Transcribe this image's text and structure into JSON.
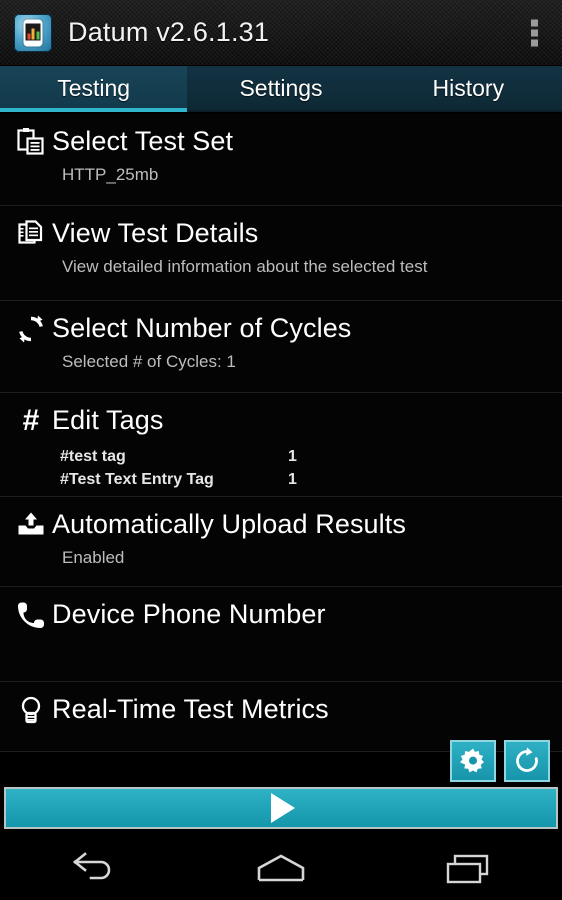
{
  "app": {
    "title": "Datum v2.6.1.31",
    "icon_name": "app-icon-phone-chart",
    "overflow_menu_label": "More options"
  },
  "theme": {
    "accent": "#1aa3b5",
    "accent_light": "#2fb6cc",
    "tabbar_bg": "#123243",
    "list_bg": "#040404",
    "title_text": "#ffffff",
    "subtitle_text": "#bdbdbd"
  },
  "tabs": [
    {
      "label": "Testing",
      "active": true
    },
    {
      "label": "Settings",
      "active": false
    },
    {
      "label": "History",
      "active": false
    }
  ],
  "list": [
    {
      "icon": "clipboard-document-icon",
      "title": "Select Test Set",
      "subtitle": "HTTP_25mb"
    },
    {
      "icon": "documents-copy-icon",
      "title": "View Test Details",
      "subtitle": "View detailed information about the selected test"
    },
    {
      "icon": "sync-cycles-icon",
      "title": "Select Number of Cycles",
      "subtitle": "Selected # of Cycles: 1"
    },
    {
      "icon": "hash-tag-icon",
      "title": "Edit Tags",
      "tags": [
        {
          "name": "#test tag",
          "value": "1"
        },
        {
          "name": "#Test Text Entry Tag",
          "value": "1"
        }
      ]
    },
    {
      "icon": "upload-tray-icon",
      "title": "Automatically Upload Results",
      "subtitle": "Enabled"
    },
    {
      "icon": "phone-handset-icon",
      "title": "Device Phone Number",
      "subtitle": ""
    },
    {
      "icon": "lightbulb-icon",
      "title": "Real-Time Test Metrics",
      "subtitle": ""
    }
  ],
  "fabs": [
    {
      "icon": "gear-icon",
      "label": "Settings"
    },
    {
      "icon": "refresh-icon",
      "label": "Refresh"
    }
  ],
  "play_button": {
    "icon": "play-icon",
    "label": "Start Test"
  },
  "navbar": [
    {
      "icon": "back-icon",
      "label": "Back"
    },
    {
      "icon": "home-icon",
      "label": "Home"
    },
    {
      "icon": "recents-icon",
      "label": "Recents"
    }
  ]
}
